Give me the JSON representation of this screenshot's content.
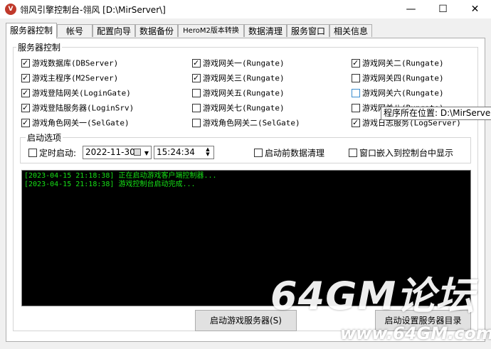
{
  "window": {
    "title": "翎风引擎控制台-翎风 [D:\\MirServer\\]",
    "icon_text": "V",
    "minimize": "—",
    "maximize": "☐",
    "close": "✕"
  },
  "tabs": [
    "服务器控制",
    "帐号",
    "配置向导",
    "数据备份",
    "HeroM2版本转换",
    "数据清理",
    "服务窗口",
    "相关信息"
  ],
  "server_group": {
    "title": "服务器控制",
    "col1": [
      {
        "label": "游戏数据库(DBServer)",
        "checked": true
      },
      {
        "label": "游戏主程序(M2Server)",
        "checked": true
      },
      {
        "label": "游戏登陆网关(LoginGate)",
        "checked": true
      },
      {
        "label": "游戏登陆服务器(LoginSrv)",
        "checked": true
      },
      {
        "label": "游戏角色网关一(SelGate)",
        "checked": true
      }
    ],
    "col2": [
      {
        "label": "游戏网关一(Rungate)",
        "checked": true
      },
      {
        "label": "游戏网关三(Rungate)",
        "checked": true
      },
      {
        "label": "游戏网关五(Rungate)",
        "checked": false
      },
      {
        "label": "游戏网关七(Rungate)",
        "checked": false
      },
      {
        "label": "游戏角色网关二(SelGate)",
        "checked": false
      }
    ],
    "col3": [
      {
        "label": "游戏网关二(Rungate)",
        "checked": true
      },
      {
        "label": "游戏网关四(Rungate)",
        "checked": false
      },
      {
        "label": "游戏网关六(Rungate)",
        "checked": false
      },
      {
        "label": "游戏网关八(Rungate)",
        "checked": false
      },
      {
        "label": "游戏日志服务(LogServer)",
        "checked": true
      }
    ]
  },
  "startup": {
    "title": "启动选项",
    "timed_label": "定时启动:",
    "timed_checked": false,
    "date": "2022-11-30",
    "time": "15:24:34",
    "clean_label": "启动前数据清理",
    "clean_checked": false,
    "embed_label": "窗口嵌入到控制台中显示",
    "embed_checked": false
  },
  "log": [
    "[2023-04-15 21:18:38] 正在启动游戏客户端控制器...",
    "[2023-04-15 21:18:38] 游戏控制台启动完成..."
  ],
  "buttons": {
    "start": "启动游戏服务器(S)",
    "server_dir": "启动设置服务器目录"
  },
  "tooltip": "程序所在位置: D:\\MirServer\\",
  "watermark": {
    "big": "64GM论坛",
    "small": "www.64GM.com"
  },
  "colors": {
    "console_bg": "#000000",
    "console_text": "#16e016"
  }
}
